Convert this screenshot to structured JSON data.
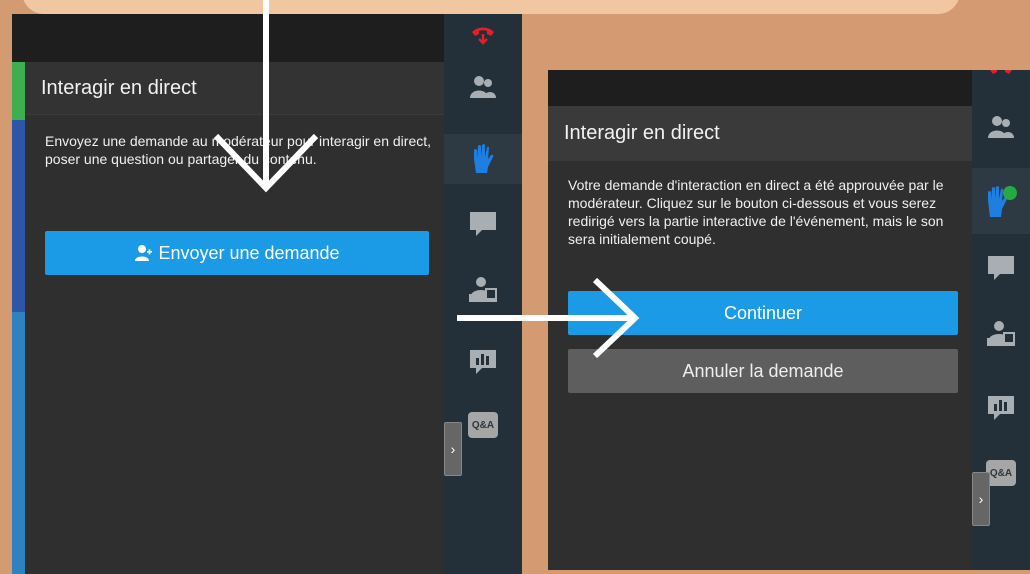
{
  "left_panel": {
    "title": "Interagir en direct",
    "description": "Envoyez une demande au modérateur pour interagir en direct, poser une question ou partager du contenu.",
    "send_button_label": "Envoyer une demande"
  },
  "right_panel": {
    "title": "Interagir en direct",
    "description": "Votre demande d'interaction en direct a été approuvée par le modérateur. Cliquez sur le bouton ci-dessous et vous serez redirigé vers la partie interactive de l'événement, mais le son sera initialement coupé.",
    "continue_button_label": "Continuer",
    "cancel_button_label": "Annuler la demande"
  },
  "sidebar": {
    "items": [
      "hangup-icon",
      "participants-icon",
      "raise-hand-icon",
      "chat-icon",
      "share-icon",
      "poll-icon",
      "qa-icon"
    ],
    "qa_label": "Q&A"
  },
  "colors": {
    "accent_blue": "#1b9be6",
    "hand_blue": "#1e7fe0",
    "hangup_red": "#e0202a",
    "background": "#d49a72"
  }
}
